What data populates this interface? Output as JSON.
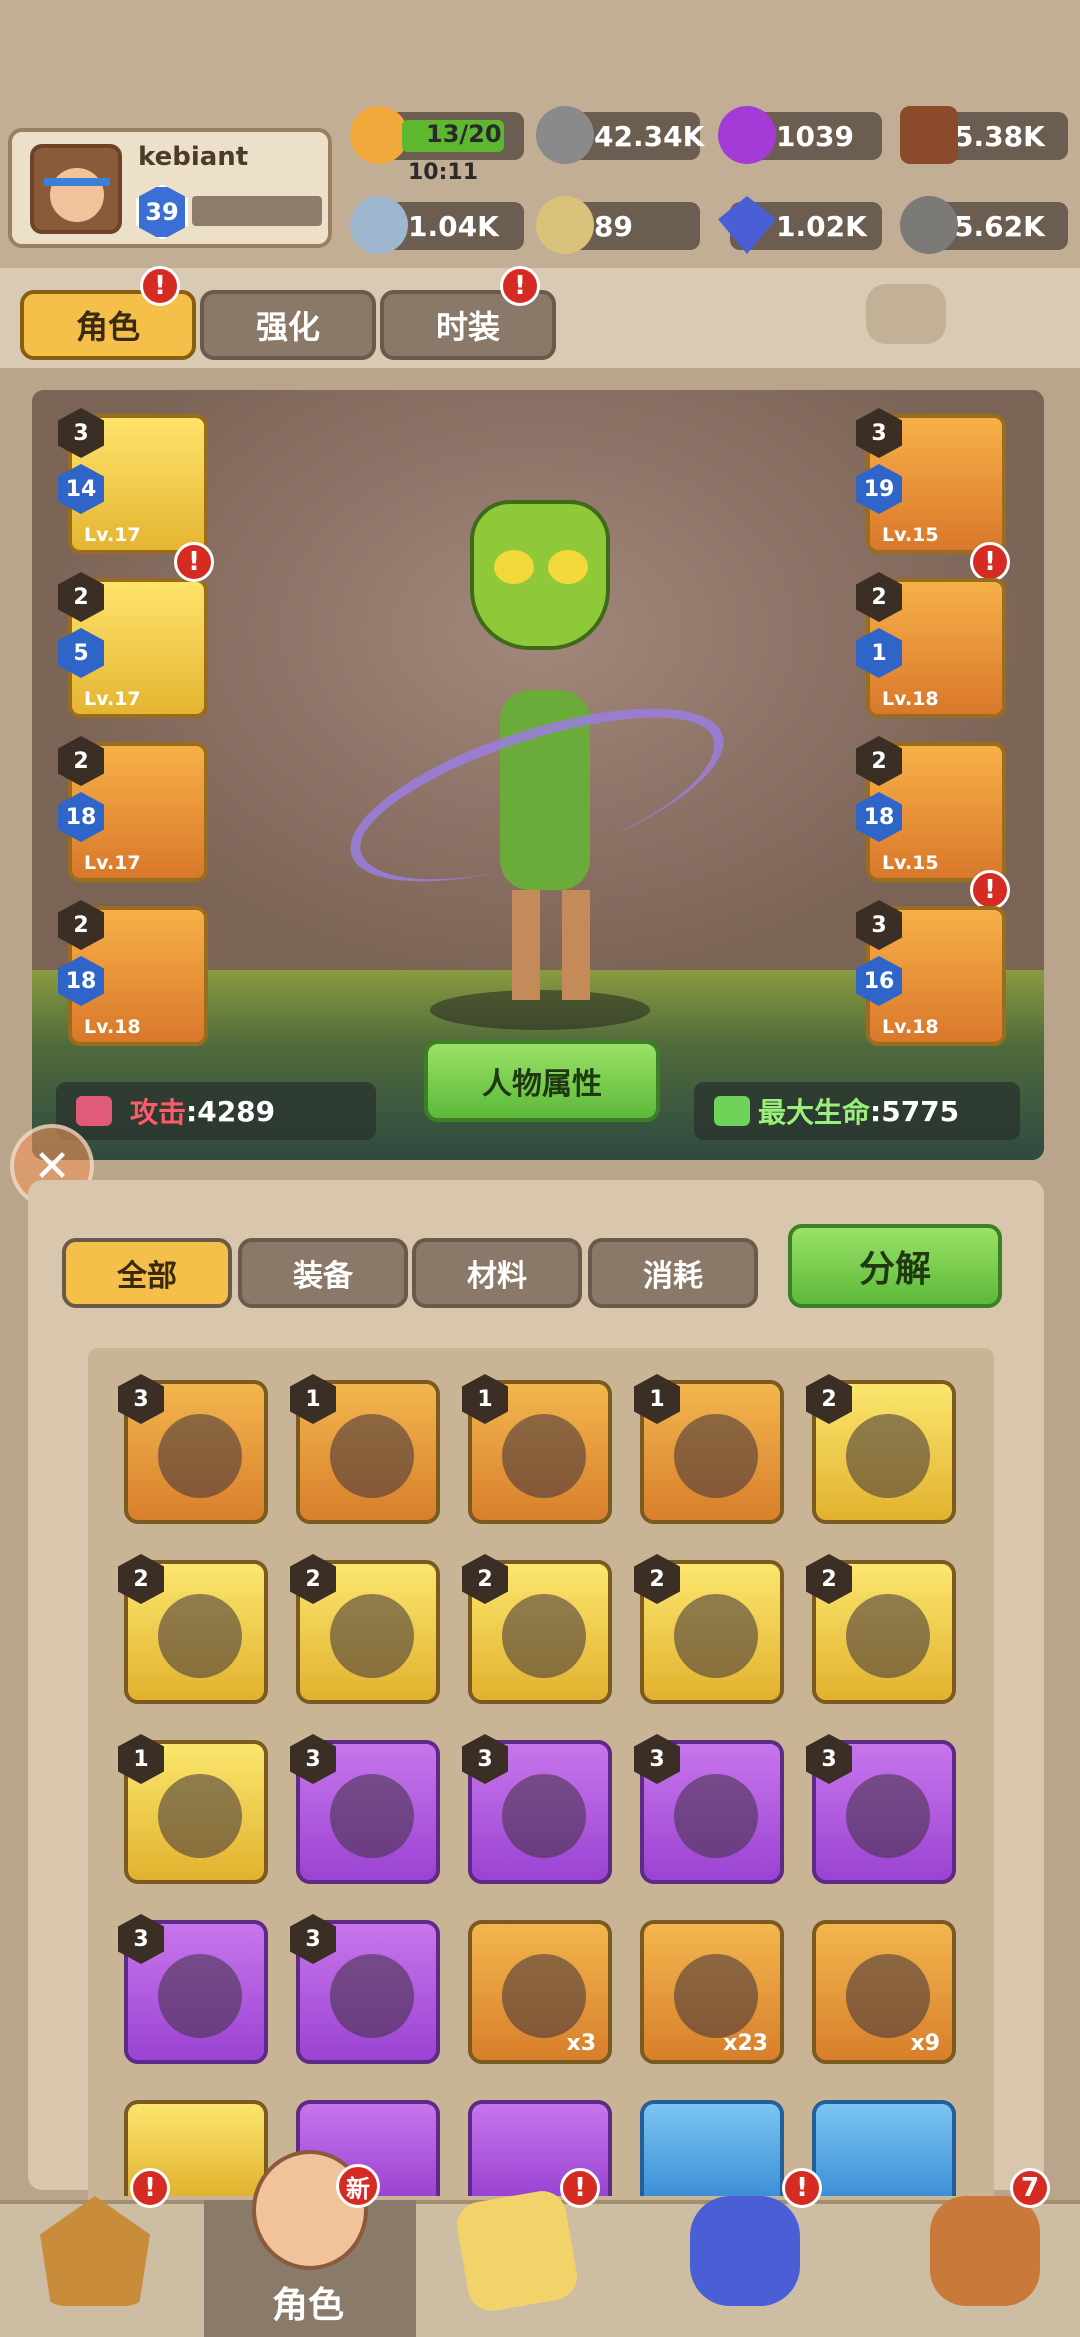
{
  "player": {
    "name": "kebiant",
    "level": "39"
  },
  "resources": {
    "energy": {
      "value": "13/20",
      "timer": "10:11",
      "icon": "energy-icon"
    },
    "gears": {
      "value": "42.34K",
      "icon": "gear-nut-icon"
    },
    "pearls": {
      "value": "1039",
      "icon": "pearl-icon"
    },
    "wood": {
      "value": "5.38K",
      "icon": "wood-icon"
    },
    "bones": {
      "value": "1.04K",
      "icon": "bone-icon"
    },
    "fossils": {
      "value": "89",
      "icon": "fossil-icon"
    },
    "crystals": {
      "value": "1.02K",
      "icon": "crystal-icon"
    },
    "stone": {
      "value": "5.62K",
      "icon": "stone-icon"
    }
  },
  "tabs": [
    "角色",
    "强化",
    "时装"
  ],
  "equipment_left": [
    {
      "rarity": "3",
      "level_badge": "14",
      "level": "Lv.17"
    },
    {
      "rarity": "2",
      "level_badge": "5",
      "level": "Lv.17"
    },
    {
      "rarity": "2",
      "level_badge": "18",
      "level": "Lv.17"
    },
    {
      "rarity": "2",
      "level_badge": "18",
      "level": "Lv.18"
    }
  ],
  "equipment_right": [
    {
      "rarity": "3",
      "level_badge": "19",
      "level": "Lv.15"
    },
    {
      "rarity": "2",
      "level_badge": "1",
      "level": "Lv.18"
    },
    {
      "rarity": "2",
      "level_badge": "18",
      "level": "Lv.15"
    },
    {
      "rarity": "3",
      "level_badge": "16",
      "level": "Lv.18"
    }
  ],
  "stats": {
    "attack_label": "攻击",
    "attack_value": ":4289",
    "hp_label": "最大生命",
    "hp_value": ":5775",
    "attributes_button": "人物属性"
  },
  "filters": [
    "全部",
    "装备",
    "材料",
    "消耗"
  ],
  "decompose_button": "分解",
  "inventory": [
    {
      "rarity": "3",
      "color": "orange"
    },
    {
      "rarity": "1",
      "color": "orange"
    },
    {
      "rarity": "1",
      "color": "orange"
    },
    {
      "rarity": "1",
      "color": "orange"
    },
    {
      "rarity": "2",
      "color": "gold"
    },
    {
      "rarity": "2",
      "color": "gold"
    },
    {
      "rarity": "2",
      "color": "gold"
    },
    {
      "rarity": "2",
      "color": "gold"
    },
    {
      "rarity": "2",
      "color": "gold"
    },
    {
      "rarity": "2",
      "color": "gold"
    },
    {
      "rarity": "1",
      "color": "gold"
    },
    {
      "rarity": "3",
      "color": "purple"
    },
    {
      "rarity": "3",
      "color": "purple"
    },
    {
      "rarity": "3",
      "color": "purple"
    },
    {
      "rarity": "3",
      "color": "purple"
    },
    {
      "rarity": "3",
      "color": "purple"
    },
    {
      "rarity": "3",
      "color": "purple"
    },
    {
      "rarity": "",
      "color": "orange",
      "qty": "x3"
    },
    {
      "rarity": "",
      "color": "orange",
      "qty": "x23"
    },
    {
      "rarity": "",
      "color": "orange",
      "qty": "x9"
    }
  ],
  "nav": {
    "character_label": "角色",
    "new_badge": "新",
    "bag_count": "7"
  }
}
